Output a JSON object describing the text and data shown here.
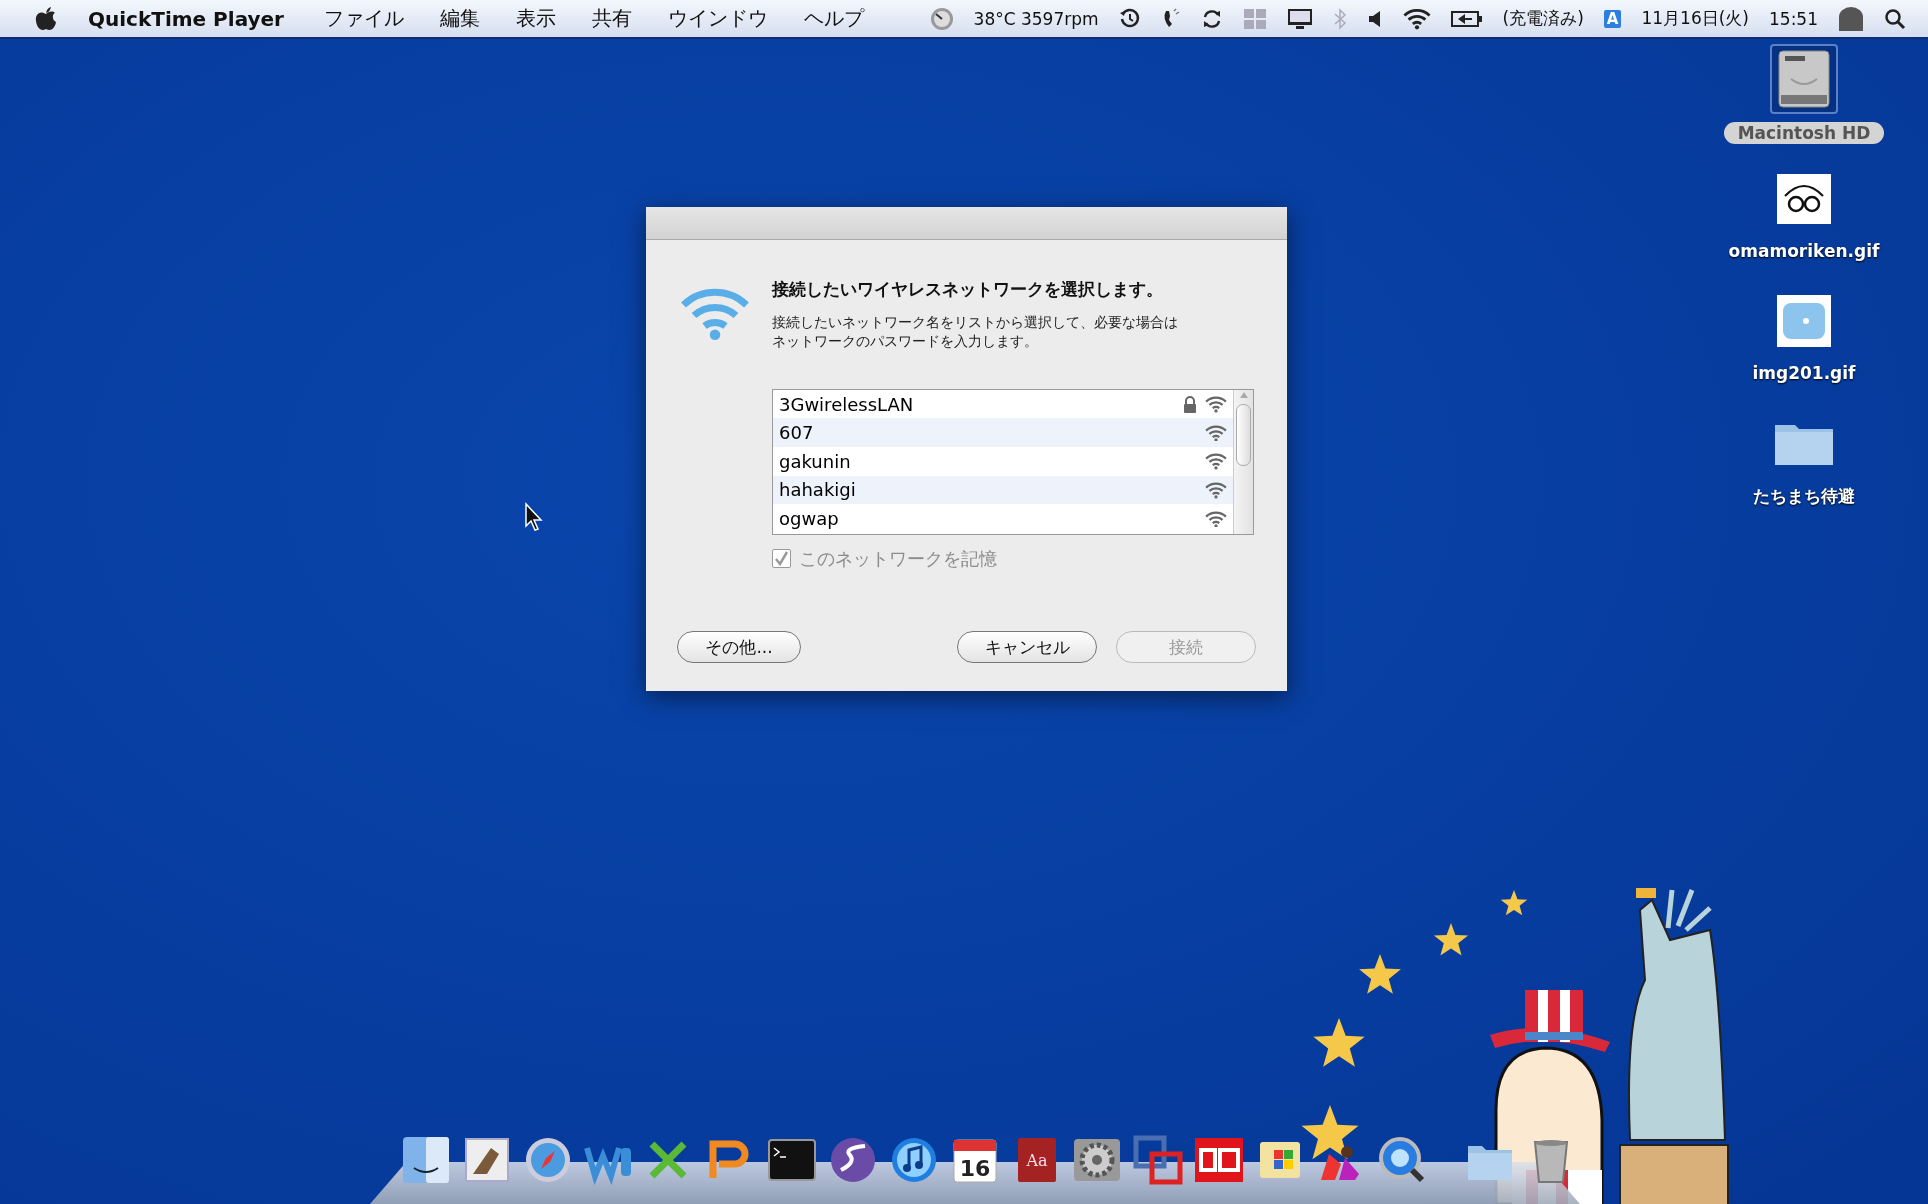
{
  "menu_bar": {
    "app_name": "QuickTime Player",
    "menus": [
      "ファイル",
      "編集",
      "表示",
      "共有",
      "ウインドウ",
      "ヘルプ"
    ],
    "status": [
      {
        "kind": "gauge"
      },
      {
        "kind": "text",
        "text": "38°C 3597rpm"
      },
      {
        "kind": "clock"
      },
      {
        "kind": "phone"
      },
      {
        "kind": "sync"
      },
      {
        "kind": "spaces"
      },
      {
        "kind": "display"
      },
      {
        "kind": "bluetooth"
      },
      {
        "kind": "volume"
      },
      {
        "kind": "wifi"
      },
      {
        "kind": "battery"
      },
      {
        "kind": "text",
        "text": "(充電済み)"
      },
      {
        "kind": "input",
        "text": "A"
      },
      {
        "kind": "text",
        "text": "11月16日(火)"
      },
      {
        "kind": "text",
        "text": "15:51"
      },
      {
        "kind": "user"
      },
      {
        "kind": "search"
      }
    ]
  },
  "dialog": {
    "heading": "接続したいワイヤレスネットワークを選択します。",
    "description_lines": [
      "接続したいネットワーク名をリストから選択して、必要な場合は",
      "ネットワークのパスワードを入力します。"
    ],
    "networks": [
      {
        "name": "3GwirelessLAN",
        "locked": true
      },
      {
        "name": "607",
        "locked": false
      },
      {
        "name": "gakunin",
        "locked": false
      },
      {
        "name": "hahakigi",
        "locked": false
      },
      {
        "name": "ogwap",
        "locked": false
      }
    ],
    "remember": {
      "label": "このネットワークを記憶",
      "checked": true,
      "disabled": true
    },
    "buttons": [
      {
        "label": "その他...",
        "disabled": false
      },
      {
        "label": "キャンセル",
        "disabled": false
      },
      {
        "label": "接続",
        "disabled": true
      }
    ]
  },
  "desktop_icons": [
    {
      "kind": "drive",
      "label": "Macintosh HD",
      "selected": true
    },
    {
      "kind": "sketch",
      "label": "omamoriken.gif",
      "selected": false
    },
    {
      "kind": "disc",
      "label": "img201.gif",
      "selected": false
    },
    {
      "kind": "folder",
      "label": "たちまち待避",
      "selected": false
    }
  ],
  "dock": [
    {
      "kind": "finder"
    },
    {
      "kind": "mail"
    },
    {
      "kind": "safari"
    },
    {
      "kind": "word"
    },
    {
      "kind": "excel"
    },
    {
      "kind": "powerpoint"
    },
    {
      "kind": "terminal"
    },
    {
      "kind": "emacs"
    },
    {
      "kind": "itunes"
    },
    {
      "kind": "calendar",
      "label": "16"
    },
    {
      "kind": "dictionary",
      "label": "Aa"
    },
    {
      "kind": "prefs"
    },
    {
      "kind": "parallels"
    },
    {
      "kind": "em"
    },
    {
      "kind": "windows"
    },
    {
      "kind": "app"
    },
    {
      "kind": "quicktime"
    },
    {
      "kind": "separator"
    },
    {
      "kind": "folder"
    },
    {
      "kind": "trash"
    }
  ]
}
